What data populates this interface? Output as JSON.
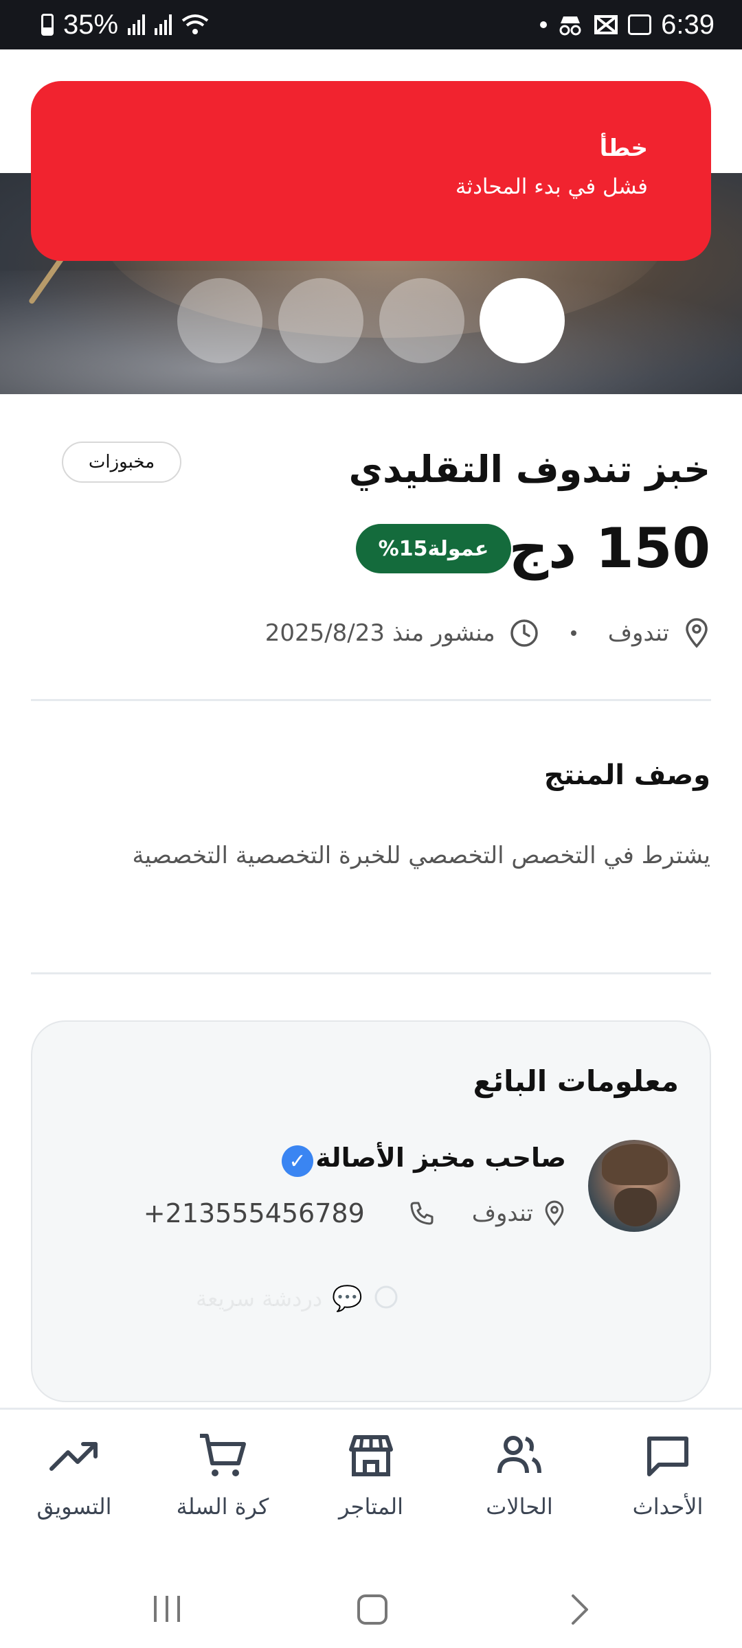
{
  "status_bar": {
    "battery": "35%",
    "time": "6:39"
  },
  "toast": {
    "title": "خطأ",
    "message": "فشل في بدء المحادثة"
  },
  "product": {
    "category": "مخبوزات",
    "title": "خبز تندوف التقليدي",
    "price": "150 دج",
    "commission": "عمولة15%",
    "location": "تندوف",
    "posted": "منشور منذ 2025/8/23"
  },
  "description": {
    "heading": "وصف المنتج",
    "text": "يشترط في التخصص التخصصي للخبرة التخصصية التخصصية"
  },
  "seller": {
    "heading": "معلومات البائع",
    "name": "صاحب مخبز الأصالة",
    "location": "تندوف",
    "phone": "+213555456789",
    "quick_chat": "دردشة سريعة"
  },
  "bottom_nav": [
    {
      "label": "الأحداث",
      "icon": "message-square-icon"
    },
    {
      "label": "الحالات",
      "icon": "users-icon"
    },
    {
      "label": "المتاجر",
      "icon": "store-icon"
    },
    {
      "label": "كرة السلة",
      "icon": "cart-icon"
    },
    {
      "label": "التسويق",
      "icon": "trending-up-icon"
    }
  ],
  "colors": {
    "toast": "#f1232f",
    "commission": "#146b3c",
    "verified": "#3a85f2"
  }
}
